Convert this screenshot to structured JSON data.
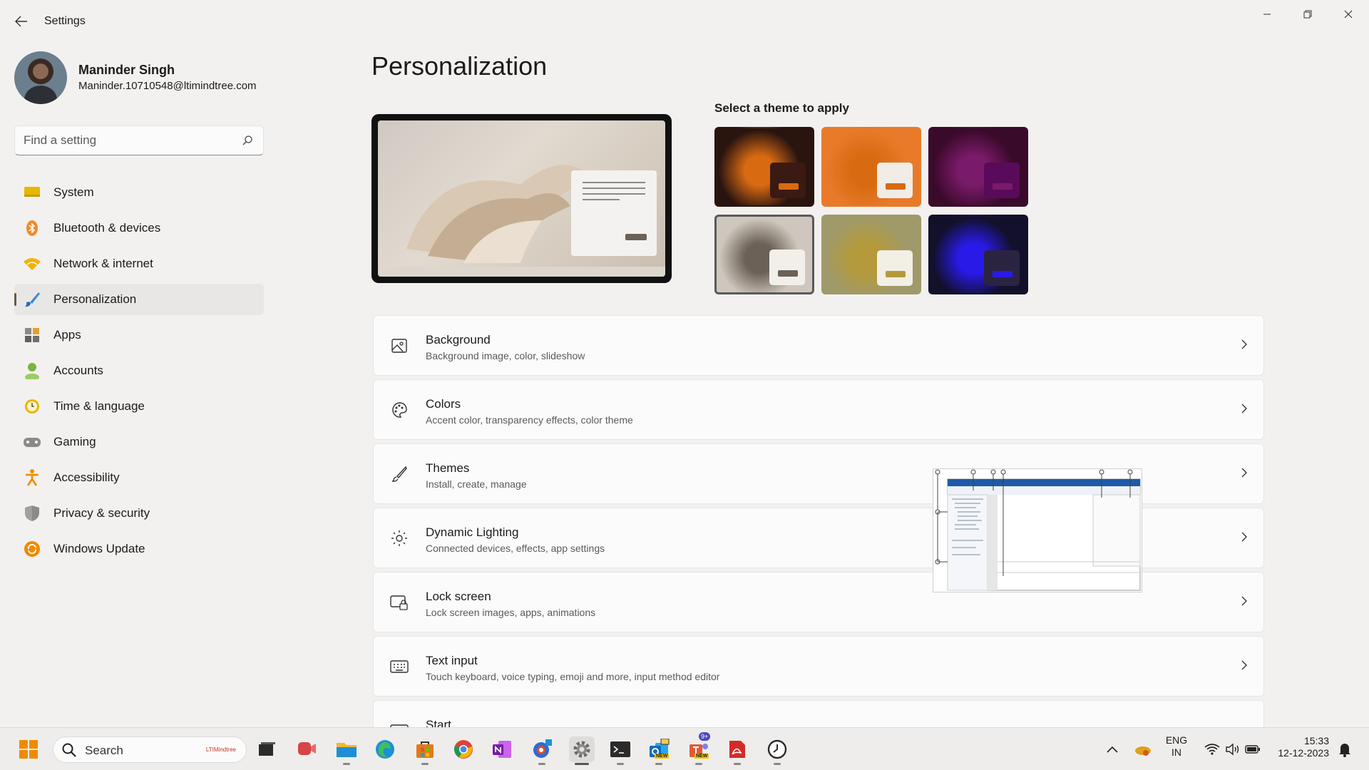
{
  "window": {
    "title": "Settings"
  },
  "profile": {
    "name": "Maninder Singh",
    "email": "Maninder.10710548@ltimindtree.com"
  },
  "search": {
    "placeholder": "Find a setting"
  },
  "nav": [
    {
      "label": "System",
      "icon": "monitor-icon"
    },
    {
      "label": "Bluetooth & devices",
      "icon": "bluetooth-icon"
    },
    {
      "label": "Network & internet",
      "icon": "wifi-icon"
    },
    {
      "label": "Personalization",
      "icon": "brush-icon",
      "active": true
    },
    {
      "label": "Apps",
      "icon": "apps-icon"
    },
    {
      "label": "Accounts",
      "icon": "person-icon"
    },
    {
      "label": "Time & language",
      "icon": "clock-globe-icon"
    },
    {
      "label": "Gaming",
      "icon": "gamepad-icon"
    },
    {
      "label": "Accessibility",
      "icon": "accessibility-icon"
    },
    {
      "label": "Privacy & security",
      "icon": "shield-icon"
    },
    {
      "label": "Windows Update",
      "icon": "update-icon"
    }
  ],
  "main": {
    "title": "Personalization",
    "theme_heading": "Select a theme to apply",
    "themes": [
      {
        "name": "dark-orange-bloom",
        "bg": "#2a1410",
        "accent": "#d86a12",
        "swatch": "#3a1a12",
        "selected": false
      },
      {
        "name": "light-orange-bloom",
        "bg": "#e87a2a",
        "accent": "#d86a12",
        "swatch": "#f2ece6",
        "selected": false
      },
      {
        "name": "dark-purple-glow",
        "bg": "#3a0a2a",
        "accent": "#7a1a6a",
        "swatch": "#5a0a5a",
        "selected": false
      },
      {
        "name": "light-flow",
        "bg": "#cfc7bd",
        "accent": "#6b6157",
        "swatch": "#f2efeb",
        "selected": true
      },
      {
        "name": "landscape-lake",
        "bg": "#a09a6a",
        "accent": "#b49a3a",
        "swatch": "#f2efe6",
        "selected": false
      },
      {
        "name": "dark-captured-motion",
        "bg": "#12102a",
        "accent": "#2a1ae8",
        "swatch": "#2a2440",
        "selected": false
      }
    ],
    "cards": [
      {
        "title": "Background",
        "desc": "Background image, color, slideshow",
        "icon": "image-icon"
      },
      {
        "title": "Colors",
        "desc": "Accent color, transparency effects, color theme",
        "icon": "palette-icon"
      },
      {
        "title": "Themes",
        "desc": "Install, create, manage",
        "icon": "brush-icon"
      },
      {
        "title": "Dynamic Lighting",
        "desc": "Connected devices, effects, app settings",
        "icon": "lighting-icon"
      },
      {
        "title": "Lock screen",
        "desc": "Lock screen images, apps, animations",
        "icon": "lock-screen-icon"
      },
      {
        "title": "Text input",
        "desc": "Touch keyboard, voice typing, emoji and more, input method editor",
        "icon": "keyboard-icon"
      },
      {
        "title": "Start",
        "desc": "",
        "icon": "start-icon"
      }
    ]
  },
  "taskbar": {
    "search_label": "Search",
    "search_brand": "LTIMindtree",
    "apps": [
      {
        "name": "task-view-icon",
        "color": "#333333"
      },
      {
        "name": "teams-meet-icon",
        "color": "#d64545"
      },
      {
        "name": "file-explorer-icon",
        "color": "#f2b632"
      },
      {
        "name": "edge-icon",
        "color": "#1e8fd6"
      },
      {
        "name": "store-icon",
        "color": "#e07b1a"
      },
      {
        "name": "chrome-icon",
        "color": "#4285f4"
      },
      {
        "name": "onenote-icon",
        "color": "#7719aa"
      },
      {
        "name": "snipping-icon",
        "color": "#2a6ad6"
      },
      {
        "name": "settings-icon",
        "color": "#6a6a6a"
      },
      {
        "name": "terminal-icon",
        "color": "#2b2b2b"
      },
      {
        "name": "outlook-icon",
        "color": "#0f6cbd"
      },
      {
        "name": "teams-icon",
        "color": "#5b5fc7"
      },
      {
        "name": "pdf-icon",
        "color": "#d42a2a"
      },
      {
        "name": "clock-app-icon",
        "color": "#3a3a3a"
      }
    ],
    "teams_badge": "9+",
    "new_badge": "NEW",
    "lang_top": "ENG",
    "lang_bottom": "IN",
    "time": "15:33",
    "date": "12-12-2023"
  }
}
